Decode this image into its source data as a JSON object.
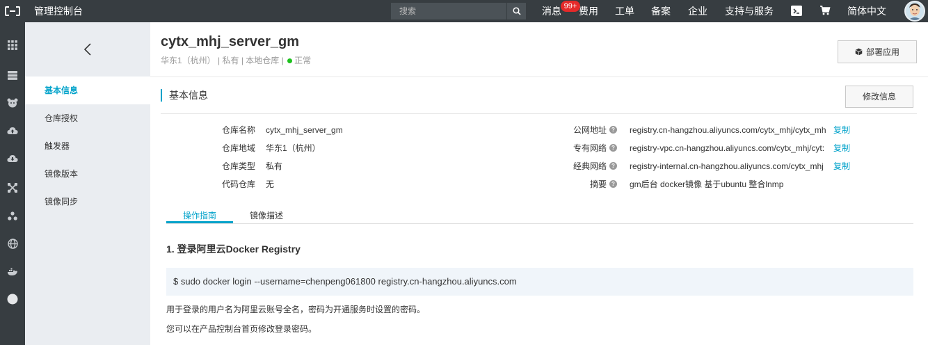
{
  "topbar": {
    "console_title": "管理控制台",
    "search_placeholder": "搜索",
    "nav": {
      "messages": "消息",
      "messages_badge": "99+",
      "billing": "费用",
      "tickets": "工单",
      "icp": "备案",
      "enterprise": "企业",
      "support": "支持与服务",
      "language": "简体中文"
    }
  },
  "iconbar": {
    "icons": [
      "grid-icon",
      "server-icon",
      "cloud-bear-icon",
      "cloud-upload-icon",
      "cloud-sync-icon",
      "cross-arrows-icon",
      "cluster-icon",
      "globe-icon",
      "docker-whale-icon",
      "circle-icon"
    ]
  },
  "subnav": {
    "items": [
      "基本信息",
      "仓库授权",
      "触发器",
      "镜像版本",
      "镜像同步"
    ]
  },
  "repo": {
    "name": "cytx_mhj_server_gm",
    "region": "华东1（杭州）",
    "visibility": "私有",
    "source": "本地仓库",
    "status": "正常",
    "deploy_label": "部署应用"
  },
  "basic_info": {
    "section_title": "基本信息",
    "edit_label": "修改信息",
    "left": [
      {
        "label": "仓库名称",
        "value": "cytx_mhj_server_gm"
      },
      {
        "label": "仓库地域",
        "value": "华东1（杭州）"
      },
      {
        "label": "仓库类型",
        "value": "私有"
      },
      {
        "label": "代码仓库",
        "value": "无"
      }
    ],
    "right": [
      {
        "label": "公网地址",
        "value": "registry.cn-hangzhou.aliyuncs.com/cytx_mhj/cytx_mh",
        "copy": "复制"
      },
      {
        "label": "专有网络",
        "value": "registry-vpc.cn-hangzhou.aliyuncs.com/cytx_mhj/cyt:",
        "copy": "复制"
      },
      {
        "label": "经典网络",
        "value": "registry-internal.cn-hangzhou.aliyuncs.com/cytx_mhj",
        "copy": "复制"
      },
      {
        "label": "摘要",
        "value": "gm后台 docker镜像 基于ubuntu 整合lnmp"
      }
    ]
  },
  "tabs": [
    "操作指南",
    "镜像描述"
  ],
  "guide": {
    "step1_title": "1. 登录阿里云Docker Registry",
    "command": "$ sudo docker login --username=chenpeng061800 registry.cn-hangzhou.aliyuncs.com",
    "note1": "用于登录的用户名为阿里云账号全名，密码为开通服务时设置的密码。",
    "note2": "您可以在产品控制台首页修改登录密码。"
  },
  "colors": {
    "topbar_bg": "#373d41",
    "accent": "#00a2ca",
    "badge": "#e52a2a",
    "status_ok": "#1dc11d",
    "subnav_bg": "#eaedf1"
  }
}
